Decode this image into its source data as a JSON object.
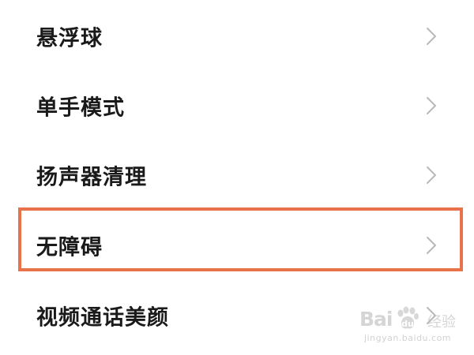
{
  "settings_list": {
    "items": [
      {
        "label": "悬浮球",
        "chevron_icon": "chevron-right-icon"
      },
      {
        "label": "单手模式",
        "chevron_icon": "chevron-right-icon"
      },
      {
        "label": "扬声器清理",
        "chevron_icon": "chevron-right-icon"
      },
      {
        "label": "无障碍",
        "chevron_icon": "chevron-right-icon",
        "highlighted": true
      },
      {
        "label": "视频通话美颜",
        "chevron_icon": "chevron-right-icon"
      }
    ]
  },
  "colors": {
    "highlight_border": "#E8734A",
    "label_text": "#1a1a1a",
    "chevron": "#b8b8b8",
    "background": "#ffffff"
  },
  "watermark": {
    "logo": "Bai",
    "logo_suffix": "经验",
    "url": "jingyan.baidu.com"
  }
}
